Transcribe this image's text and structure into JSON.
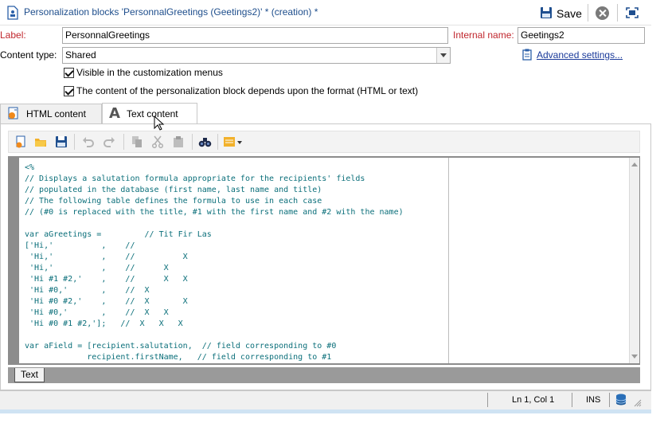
{
  "window": {
    "title": "Personalization blocks 'PersonnalGreetings (Geetings2)' * (creation) *",
    "save_label": "Save"
  },
  "form": {
    "label_caption": "Label:",
    "label_value": "PersonnalGreetings",
    "internal_name_caption": "Internal name:",
    "internal_name_value": "Geetings2",
    "content_type_caption": "Content type:",
    "content_type_value": "Shared",
    "advanced_settings_link": "Advanced settings...",
    "visible_checkbox_label": "Visible in the customization menus",
    "visible_checked": true,
    "depends_checkbox_label": "The content of the personalization block depends upon the format (HTML or text)",
    "depends_checked": true
  },
  "tabs": [
    {
      "label": "HTML content",
      "active": false
    },
    {
      "label": "Text content",
      "active": true
    }
  ],
  "editor": {
    "code": "<%\n// Displays a salutation formula appropriate for the recipients' fields\n// populated in the database (first name, last name and title)\n// The following table defines the formula to use in each case\n// (#0 is replaced with the title, #1 with the first name and #2 with the name)\n\nvar aGreetings =         // Tit Fir Las\n['Hi,'          ,    //\n 'Hi,'          ,    //          X\n 'Hi,'          ,    //      X\n 'Hi #1 #2,'    ,    //      X   X\n 'Hi #0,'       ,    //  X\n 'Hi #0 #2,'    ,    //  X       X\n 'Hi #0,'       ,    //  X   X\n 'Hi #0 #1 #2,'];   //  X   X   X\n\nvar aField = [recipient.salutation,  // field corresponding to #0\n             recipient.firstName,   // field corresponding to #1",
    "bottom_tab": "Text"
  },
  "status": {
    "position": "Ln 1, Col 1",
    "mode": "INS"
  },
  "colors": {
    "title": "#1e4e8c",
    "required_label": "#c0262d",
    "link": "#1a3a9a",
    "code": "#0b6f7a"
  }
}
